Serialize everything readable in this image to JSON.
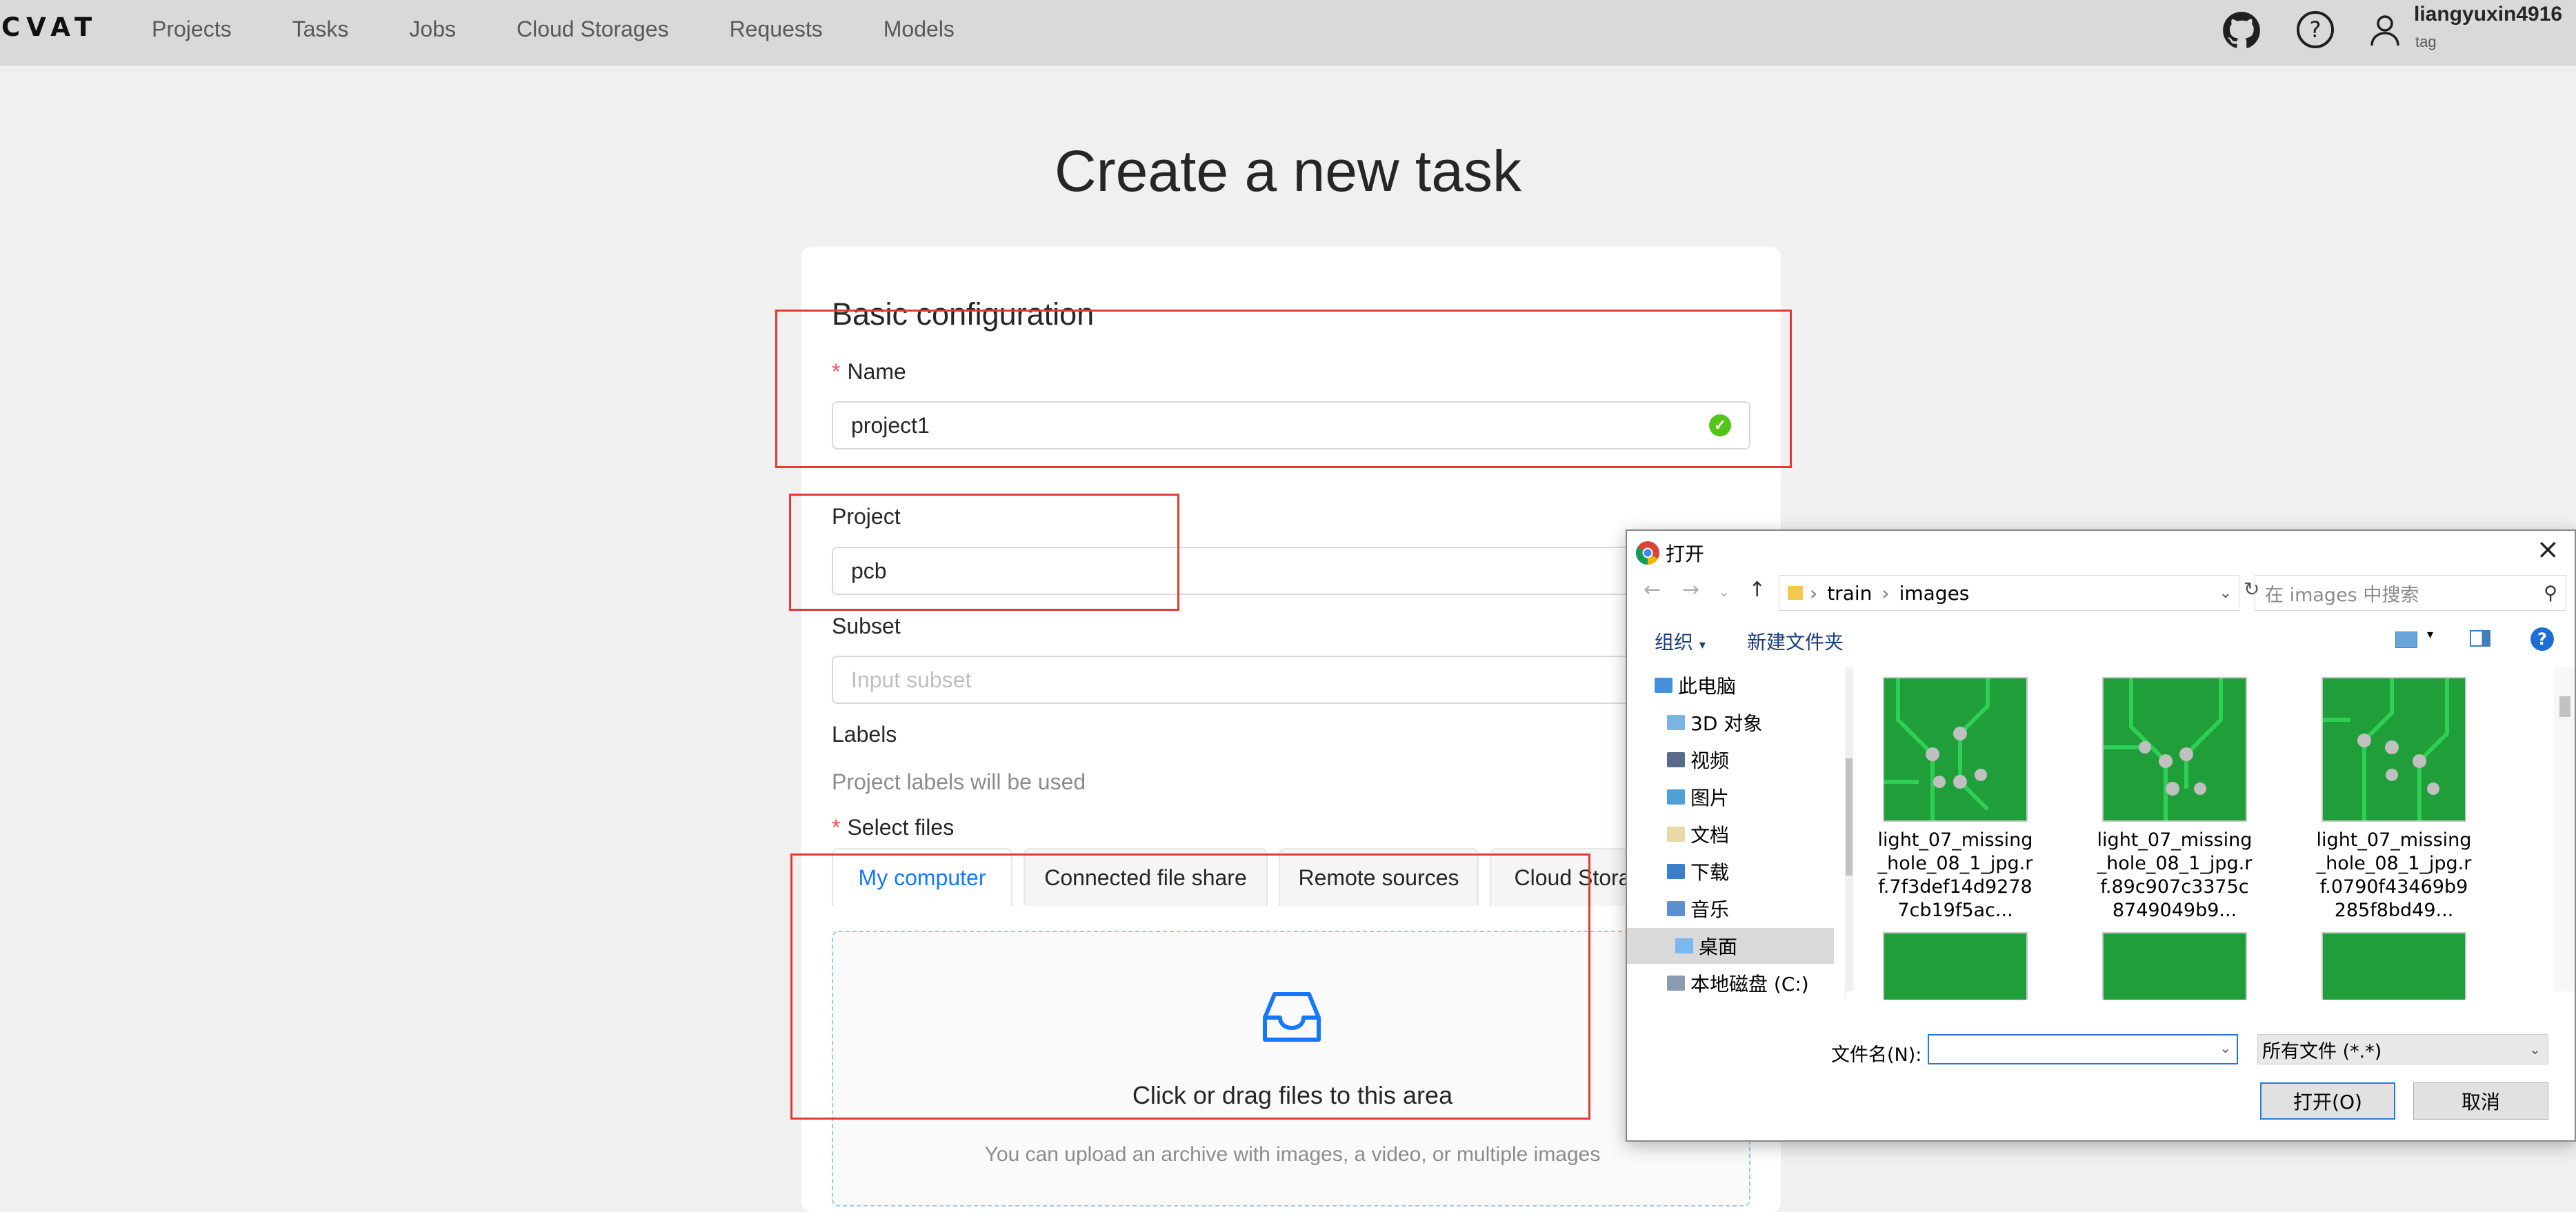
{
  "app": {
    "logo": "CVAT"
  },
  "nav": [
    "Projects",
    "Tasks",
    "Jobs",
    "Cloud Storages",
    "Requests",
    "Models"
  ],
  "user": {
    "name": "liangyuxin4916",
    "subtitle": "tag"
  },
  "page": {
    "title": "Create a new task"
  },
  "form": {
    "section_title": "Basic configuration",
    "name_label": "Name",
    "name_value": "project1",
    "project_label": "Project",
    "project_value": "pcb",
    "subset_label": "Subset",
    "subset_placeholder": "Input subset",
    "labels_label": "Labels",
    "labels_note": "Project labels will be used",
    "select_files_label": "Select files",
    "tabs": [
      "My computer",
      "Connected file share",
      "Remote sources",
      "Cloud Stora"
    ],
    "active_tab": "My computer",
    "dropzone_text": "Click or drag files to this area",
    "dropzone_hint": "You can upload an archive with images, a video, or multiple images"
  },
  "colors": {
    "accent": "#1677ff",
    "annotation": "#e53935",
    "success": "#52c41a",
    "required": "#ff4d4f"
  },
  "dialog": {
    "title": "打开",
    "path": [
      "train",
      "images"
    ],
    "search_placeholder": "在 images 中搜索",
    "organize_label": "组织",
    "new_folder_label": "新建文件夹",
    "tree": [
      "此电脑",
      "3D 对象",
      "视频",
      "图片",
      "文档",
      "下载",
      "音乐",
      "桌面",
      "本地磁盘 (C:)"
    ],
    "selected_tree_item": "桌面",
    "files": [
      {
        "label": "light_07_missing_hole_08_1_jpg.rf.7f3def14d92787cb19f5ac..."
      },
      {
        "label": "light_07_missing_hole_08_1_jpg.rf.89c907c3375c8749049b9..."
      },
      {
        "label": "light_07_missing_hole_08_1_jpg.rf.0790f43469b9285f8bd49..."
      }
    ],
    "filename_label": "文件名(N):",
    "filename_value": "",
    "filetype": "所有文件 (*.*)",
    "open_button": "打开(O)",
    "cancel_button": "取消"
  }
}
